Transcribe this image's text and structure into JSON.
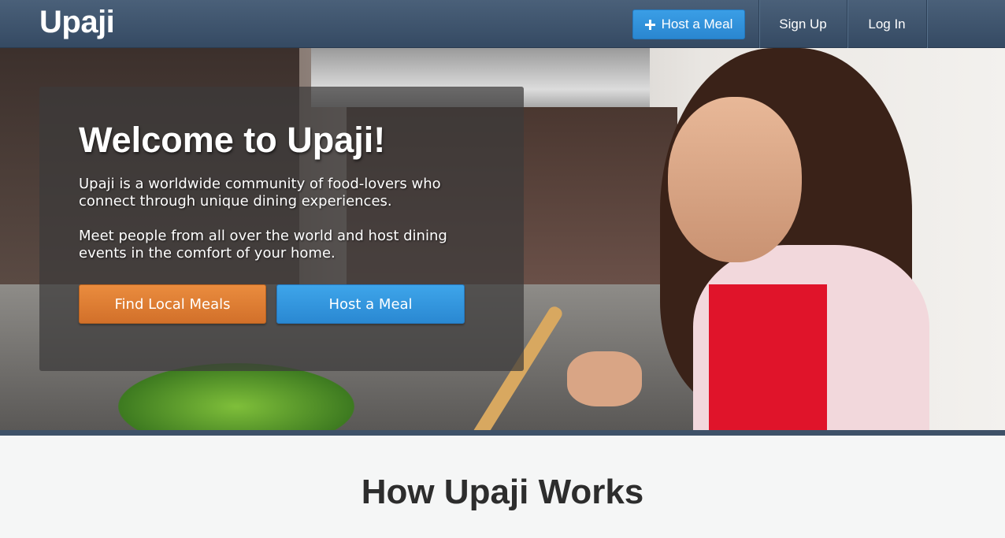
{
  "navbar": {
    "brand": "Upaji",
    "host_label": "Host a Meal",
    "host_icon": "plus-icon",
    "signup_label": "Sign Up",
    "login_label": "Log In"
  },
  "hero": {
    "title": "Welcome to Upaji!",
    "paragraph1": "Upaji is a worldwide community of food-lovers who connect through unique dining experiences.",
    "paragraph2": "Meet people from all over the world and host dining events in the comfort of your home.",
    "find_button": "Find Local Meals",
    "host_button": "Host a Meal",
    "image": "woman-cooking-in-kitchen"
  },
  "section": {
    "title": "How Upaji Works"
  },
  "colors": {
    "navbar": "#3f556e",
    "primary_blue": "#3399e0",
    "orange": "#e07f35",
    "accent_border": "#3e5168"
  }
}
